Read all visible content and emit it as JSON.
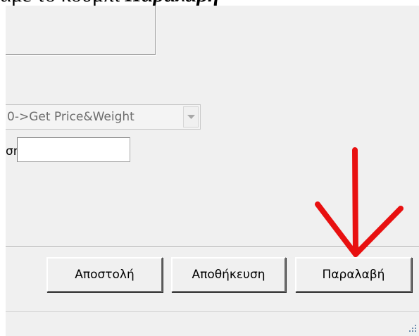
{
  "caption": {
    "text_prefix": "αμε το κουμπί",
    "text_bold": "Παραλαβή"
  },
  "form": {
    "combo_value": "0->Get Price&Weight",
    "field_label": "ση"
  },
  "buttons": {
    "send_label": "Αποστολή",
    "save_label": "Αποθήκευση",
    "receive_label": "Παραλαβή"
  },
  "annotation": {
    "arrow_color": "#e81010"
  }
}
